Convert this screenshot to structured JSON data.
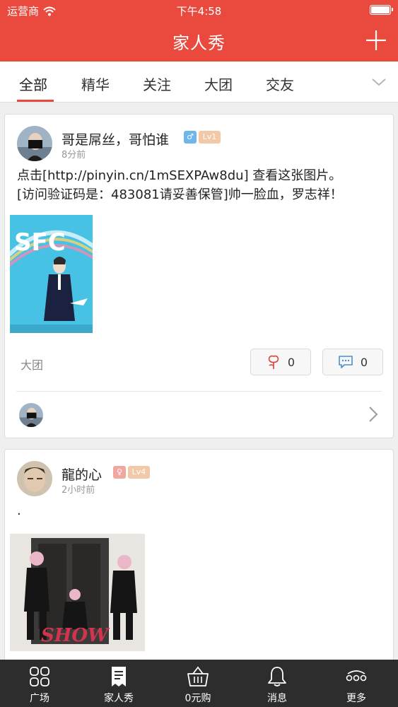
{
  "status_bar": {
    "carrier": "运营商",
    "time": "下午4:58"
  },
  "nav": {
    "title": "家人秀"
  },
  "tabs": [
    {
      "label": "全部",
      "active": true
    },
    {
      "label": "精华"
    },
    {
      "label": "关注"
    },
    {
      "label": "大团"
    },
    {
      "label": "交友"
    }
  ],
  "posts": [
    {
      "username": "哥是屌丝，哥怕谁",
      "gender_icon": "male-icon",
      "level": "Lv1",
      "time": "8分前",
      "text_lines": [
        "点击[http://pinyin.cn/1mSEXPAw8du] 查看这张图片。",
        "[访问验证码是：483081请妥善保管]帅一脸血，罗志祥！"
      ],
      "image_text": "SFC",
      "tag": "大团",
      "likes": "0",
      "comments": "0"
    },
    {
      "username": "龍的心",
      "gender_icon": "female-icon",
      "level": "Lv4",
      "time": "2小时前",
      "text": ".",
      "image_text": "SHOW"
    }
  ],
  "tabbar": [
    {
      "label": "广场",
      "icon": "grid-icon"
    },
    {
      "label": "家人秀",
      "icon": "note-icon",
      "active": true
    },
    {
      "label": "0元购",
      "icon": "basket-icon"
    },
    {
      "label": "消息",
      "icon": "bell-icon"
    },
    {
      "label": "更多",
      "icon": "more-icon"
    }
  ],
  "colors": {
    "brand": "#ea4a3e",
    "male_badge": "#6fb6ea",
    "female_badge": "#f2a6a0",
    "level_badge": "#f1c9a8",
    "tabbar_bg": "#2d2d2d"
  }
}
